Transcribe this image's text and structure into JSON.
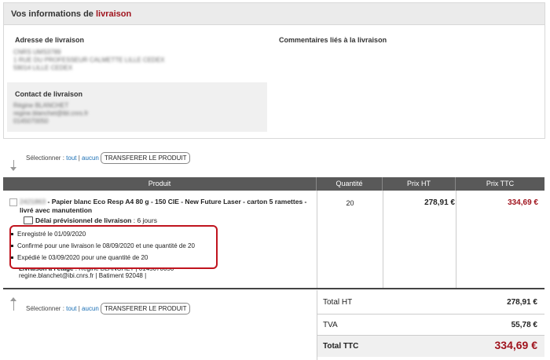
{
  "delivery_panel": {
    "title_prefix": "Vos informations de",
    "title_accent": "livraison",
    "address_label": "Adresse de livraison",
    "address_lines": [
      "CNRS UMS3789",
      "1 RUE DU PROFESSEUR CALMETTE LILLE CEDEX",
      "59014 LILLE CEDEX"
    ],
    "comments_label": "Commentaires liés à la livraison",
    "contact_label": "Contact de livraison",
    "contact_lines": [
      "Régine BLANCHET",
      "regine.blanchet@ibl.cnrs.fr",
      "0145070050"
    ]
  },
  "selection": {
    "prefix": "Sélectionner :",
    "all": "tout",
    "separator": "|",
    "none": "aucun",
    "transfer_button": "TRANSFERER LE PRODUIT"
  },
  "table": {
    "headers": [
      "Produit",
      "Quantité",
      "Prix HT",
      "Prix TTC"
    ]
  },
  "item": {
    "ref": "2421863",
    "separator": "-",
    "name": "Papier blanc Eco Resp A4 80 g - 150 CIE - New Future Laser - carton 5 ramettes - livré avec manutention",
    "delay_label": "Délai prévisionnel de livraison",
    "delay_value": ": 6 jours",
    "steps": [
      "Enregistré le 01/09/2020",
      "Confirmé pour une livraison le 08/09/2020 et une quantité de 20",
      "Expédié le 03/09/2020 pour une quantité de 20"
    ],
    "floor_label": "Livraison à l'étage",
    "floor_value": ": Régine BLANCHET | 0145070050",
    "floor_line2": "regine.blanchet@ibi.cnrs.fr | Batiment 92048 |",
    "quantity": "20",
    "price_ht": "278,91 €",
    "price_ttc": "334,69 €"
  },
  "totals": {
    "ht_label": "Total HT",
    "ht_value": "278,91 €",
    "tva_label": "TVA",
    "tva_value": "55,78 €",
    "ttc_label": "Total TTC",
    "ttc_value": "334,69 €"
  },
  "colors": {
    "accent": "#a0141e",
    "header_bg": "#595959",
    "link": "#1a6fb5"
  }
}
